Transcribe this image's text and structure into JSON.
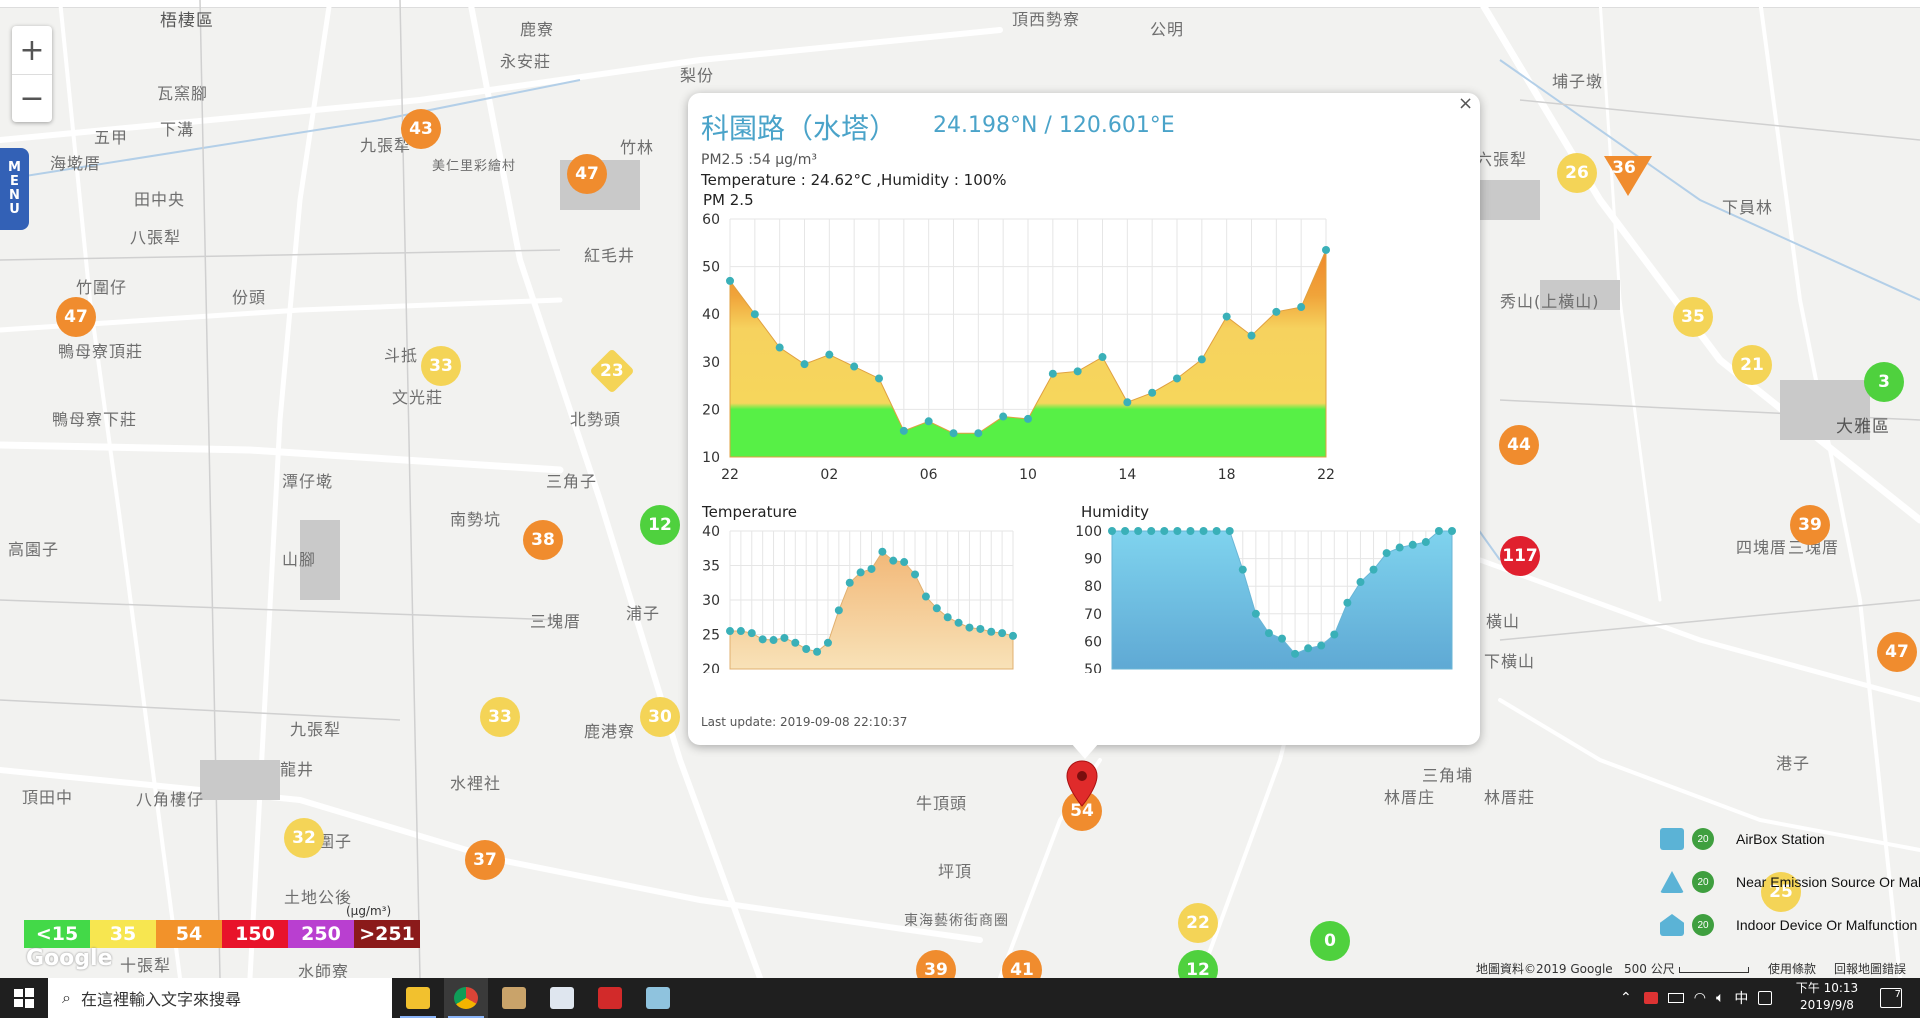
{
  "map": {
    "zoom_in_label": "+",
    "zoom_out_label": "−",
    "menu_label": [
      "M",
      "E",
      "N",
      "U"
    ],
    "places": [
      "梧棲區",
      "鹿寮",
      "頂西勢寮",
      "公明",
      "永安莊",
      "梨份",
      "瓦窯腳",
      "五甲",
      "下溝",
      "九張犁",
      "竹林",
      "埔子墩",
      "六張犁",
      "海墘厝",
      "田中央",
      "八張犁",
      "美仁里彩繪村",
      "紅毛井",
      "竹圍仔",
      "份頭",
      "下員林",
      "斗抵",
      "文光莊",
      "秀山(上橫山)",
      "鴨母寮頂莊",
      "北勢頭",
      "鴨母寮下莊",
      "大雅區",
      "三角子",
      "潭仔墘",
      "南勢坑",
      "高園子",
      "山腳",
      "浦子",
      "四塊厝",
      "三塊厝",
      "三塊厝",
      "橫山",
      "下橫山",
      "九張犁",
      "頂田中",
      "八角樓仔",
      "龍井",
      "水裡社",
      "鹿港寮",
      "牛頂頭",
      "三角埔",
      "林厝庄",
      "林厝莊",
      "港子",
      "圍子",
      "坪頂",
      "土地公後",
      "東海藝術街商圈",
      "十張犁",
      "水師寮"
    ],
    "markers": [
      "43",
      "47",
      "47",
      "33",
      "23",
      "12",
      "38",
      "33",
      "30",
      "32",
      "37",
      "26",
      "36",
      "35",
      "21",
      "3",
      "44",
      "39",
      "117",
      "47",
      "54",
      "22",
      "0",
      "39",
      "41",
      "12",
      "25"
    ],
    "legend_unit": "(μg/m³)",
    "legend": [
      {
        "label": "<15",
        "color": "#43d948"
      },
      {
        "label": "35",
        "color": "#f7e650"
      },
      {
        "label": "54",
        "color": "#f2922a"
      },
      {
        "label": "150",
        "color": "#e8132a"
      },
      {
        "label": "250",
        "color": "#b93fd0"
      },
      {
        "label": ">251",
        "color": "#8b1a1a"
      }
    ],
    "google_label": "Google",
    "attribution": "地圖資料©2019 Google",
    "scale": "500 公尺",
    "terms": "使用條款",
    "report": "回報地圖錯誤",
    "station_legend": [
      {
        "label": "AirBox Station",
        "num": "20"
      },
      {
        "label": "Near Emission Source Or Malfunction",
        "num": "20"
      },
      {
        "label": "Indoor Device Or Malfunction",
        "num": "20"
      }
    ]
  },
  "popup": {
    "close_label": "×",
    "title": "科園路（水塔）",
    "coordinates": "24.198°N / 120.601°E",
    "pm_text": "PM2.5 :54 μg/m³",
    "temp_humidity_text": "Temperature : 24.62°C ,Humidity : 100%",
    "pm_chart_label": "PM 2.5",
    "temperature_label": "Temperature",
    "humidity_label": "Humidity",
    "last_update": "Last update: 2019-09-08 22:10:37"
  },
  "chart_data": [
    {
      "type": "area",
      "title": "PM 2.5",
      "x_ticks": [
        "22",
        "02",
        "06",
        "10",
        "14",
        "18",
        "22"
      ],
      "ylim": [
        10,
        60
      ],
      "y_ticks": [
        10,
        20,
        30,
        40,
        50,
        60
      ],
      "values": [
        47,
        40,
        33,
        29.5,
        31.5,
        29,
        26.5,
        15.5,
        17.5,
        15,
        15,
        18.5,
        18,
        27.5,
        28,
        31,
        21.5,
        23.5,
        26.5,
        30.5,
        39.5,
        35.5,
        40.5,
        41.5,
        53.5
      ],
      "grid": true
    },
    {
      "type": "area",
      "title": "Temperature",
      "ylim": [
        20,
        40
      ],
      "y_ticks": [
        20,
        25,
        30,
        35,
        40
      ],
      "values": [
        25.5,
        25.5,
        25.2,
        24.3,
        24.2,
        24.5,
        23.8,
        22.9,
        22.5,
        23.8,
        28.5,
        32.5,
        34,
        34.5,
        37,
        35.7,
        35.5,
        33.7,
        30.5,
        28.8,
        27.5,
        26.7,
        26,
        25.8,
        25.4,
        25.2,
        24.8
      ],
      "grid": true
    },
    {
      "type": "area",
      "title": "Humidity",
      "ylim": [
        50,
        100
      ],
      "y_ticks": [
        50,
        60,
        70,
        80,
        90,
        100
      ],
      "values": [
        100,
        100,
        100,
        100,
        100,
        100,
        100,
        100,
        100,
        100,
        86,
        70,
        63,
        61,
        55.5,
        57.5,
        58.5,
        62.5,
        74,
        81.5,
        86,
        92,
        94,
        95,
        96,
        100,
        100
      ],
      "grid": true
    }
  ],
  "taskbar": {
    "search_placeholder": "在這裡輸入文字來搜尋",
    "time": "下午 10:13",
    "date": "2019/9/8",
    "ime": "中",
    "notification_count": "7"
  }
}
